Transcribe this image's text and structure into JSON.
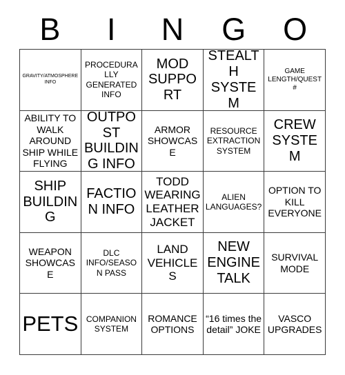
{
  "header": {
    "letters": [
      "B",
      "I",
      "N",
      "G",
      "O"
    ]
  },
  "grid": {
    "rows": 5,
    "columns": 5,
    "border_color": "#3a3a3a",
    "background_color": "#ffffff",
    "text_color": "#000000",
    "cells": [
      {
        "text": "GRAVITY/ATMOSPHERE INFO",
        "size": "sz-xxs"
      },
      {
        "text": "PROCEDURALLY GENERATED INFO",
        "size": "sz-s"
      },
      {
        "text": "MOD SUPPORT",
        "size": "sz-xl"
      },
      {
        "text": "STEALTH SYSTEM",
        "size": "sz-xl"
      },
      {
        "text": "GAME LENGTH/QUEST #",
        "size": "sz-xs"
      },
      {
        "text": "ABILITY TO WALK AROUND SHIP WHILE FLYING",
        "size": "sz-m"
      },
      {
        "text": "OUTPOST BUILDING INFO",
        "size": "sz-xl"
      },
      {
        "text": "ARMOR SHOWCASE",
        "size": "sz-m"
      },
      {
        "text": "RESOURCE EXTRACTION SYSTEM",
        "size": "sz-s"
      },
      {
        "text": "CREW SYSTEM",
        "size": "sz-xl"
      },
      {
        "text": "SHIP BUILDING",
        "size": "sz-xl"
      },
      {
        "text": "FACTION INFO",
        "size": "sz-xl"
      },
      {
        "text": "TODD WEARING LEATHER JACKET",
        "size": "sz-l"
      },
      {
        "text": "ALIEN LANGUAGES?",
        "size": "sz-s"
      },
      {
        "text": "OPTION TO KILL EVERYONE",
        "size": "sz-m"
      },
      {
        "text": "WEAPON SHOWCASE",
        "size": "sz-m"
      },
      {
        "text": "DLC INFO/SEASON PASS",
        "size": "sz-s"
      },
      {
        "text": "LAND VEHICLES",
        "size": "sz-l"
      },
      {
        "text": "NEW ENGINE TALK",
        "size": "sz-xl"
      },
      {
        "text": "SURVIVAL MODE",
        "size": "sz-m"
      },
      {
        "text": "PETS",
        "size": "sz-xxl"
      },
      {
        "text": "COMPANION SYSTEM",
        "size": "sz-s"
      },
      {
        "text": "ROMANCE OPTIONS",
        "size": "sz-m"
      },
      {
        "text": "“16 times the detail” JOKE",
        "size": "sz-m"
      },
      {
        "text": "VASCO UPGRADES",
        "size": "sz-m"
      }
    ]
  }
}
